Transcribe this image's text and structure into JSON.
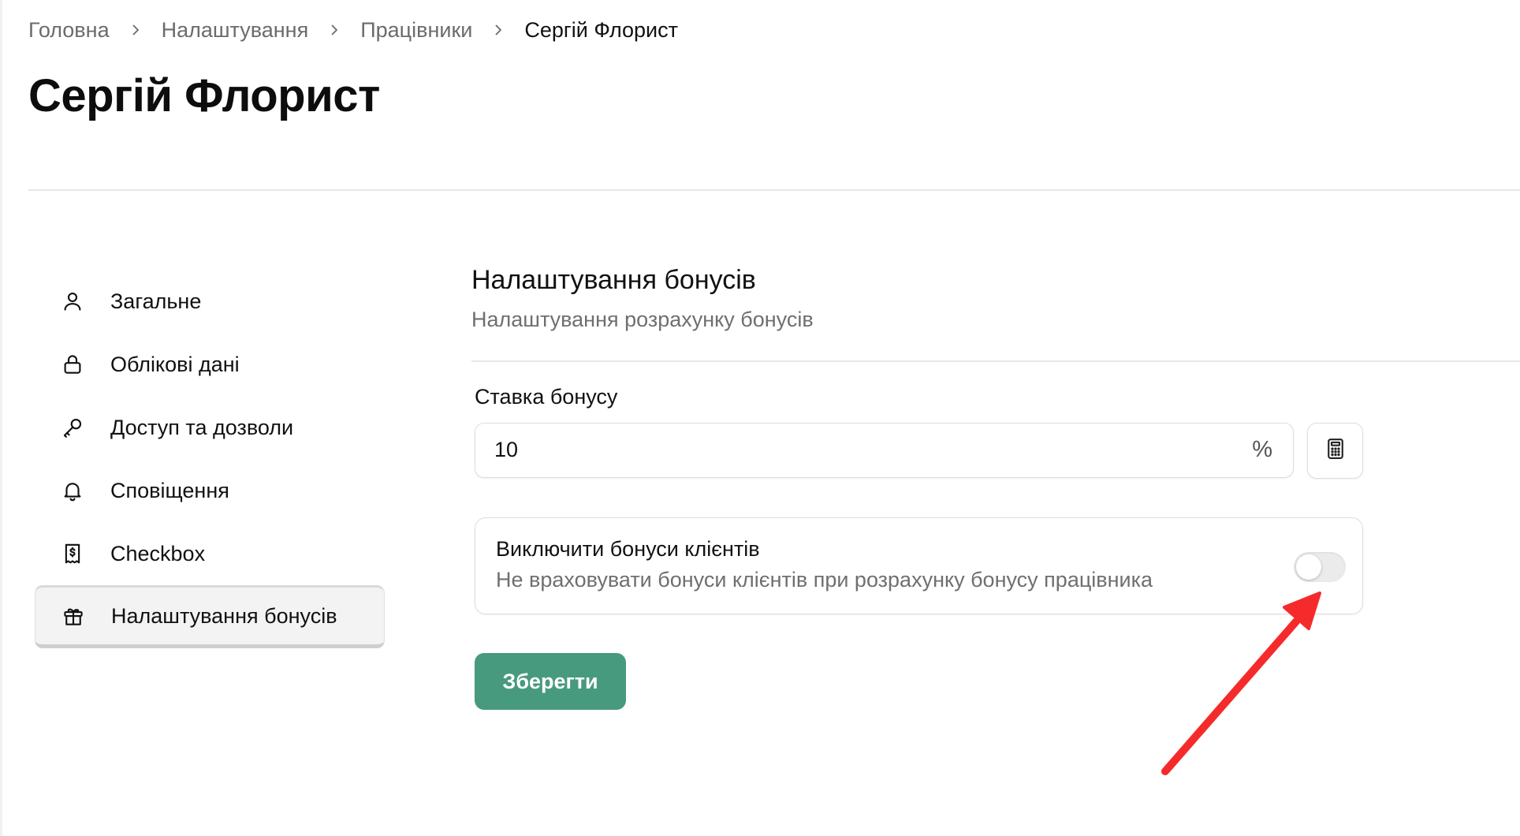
{
  "breadcrumb": {
    "items": [
      "Головна",
      "Налаштування",
      "Працівники",
      "Сергій Флорист"
    ]
  },
  "page": {
    "title": "Сергій Флорист"
  },
  "sidebar": {
    "items": [
      {
        "label": "Загальне",
        "icon": "user-icon",
        "active": false
      },
      {
        "label": "Облікові дані",
        "icon": "lock-icon",
        "active": false
      },
      {
        "label": "Доступ та дозволи",
        "icon": "key-icon",
        "active": false
      },
      {
        "label": "Сповіщення",
        "icon": "bell-icon",
        "active": false
      },
      {
        "label": "Checkbox",
        "icon": "receipt-icon",
        "active": false
      },
      {
        "label": "Налаштування бонусів",
        "icon": "gift-icon",
        "active": true
      }
    ]
  },
  "main": {
    "section_title": "Налаштування бонусів",
    "section_subtitle": "Налаштування розрахунку бонусів",
    "bonus_rate": {
      "label": "Ставка бонусу",
      "value": "10",
      "suffix": "%",
      "calculator_icon": "calculator-icon"
    },
    "exclude_client_bonuses": {
      "title": "Виключити бонуси клієнтів",
      "description": "Не враховувати бонуси клієнтів при розрахунку бонусу працівника",
      "enabled": false
    },
    "save_label": "Зберегти"
  },
  "colors": {
    "accent": "#479a7e",
    "annotation_arrow": "#f52b2b",
    "muted_text": "#6f6f6f"
  }
}
